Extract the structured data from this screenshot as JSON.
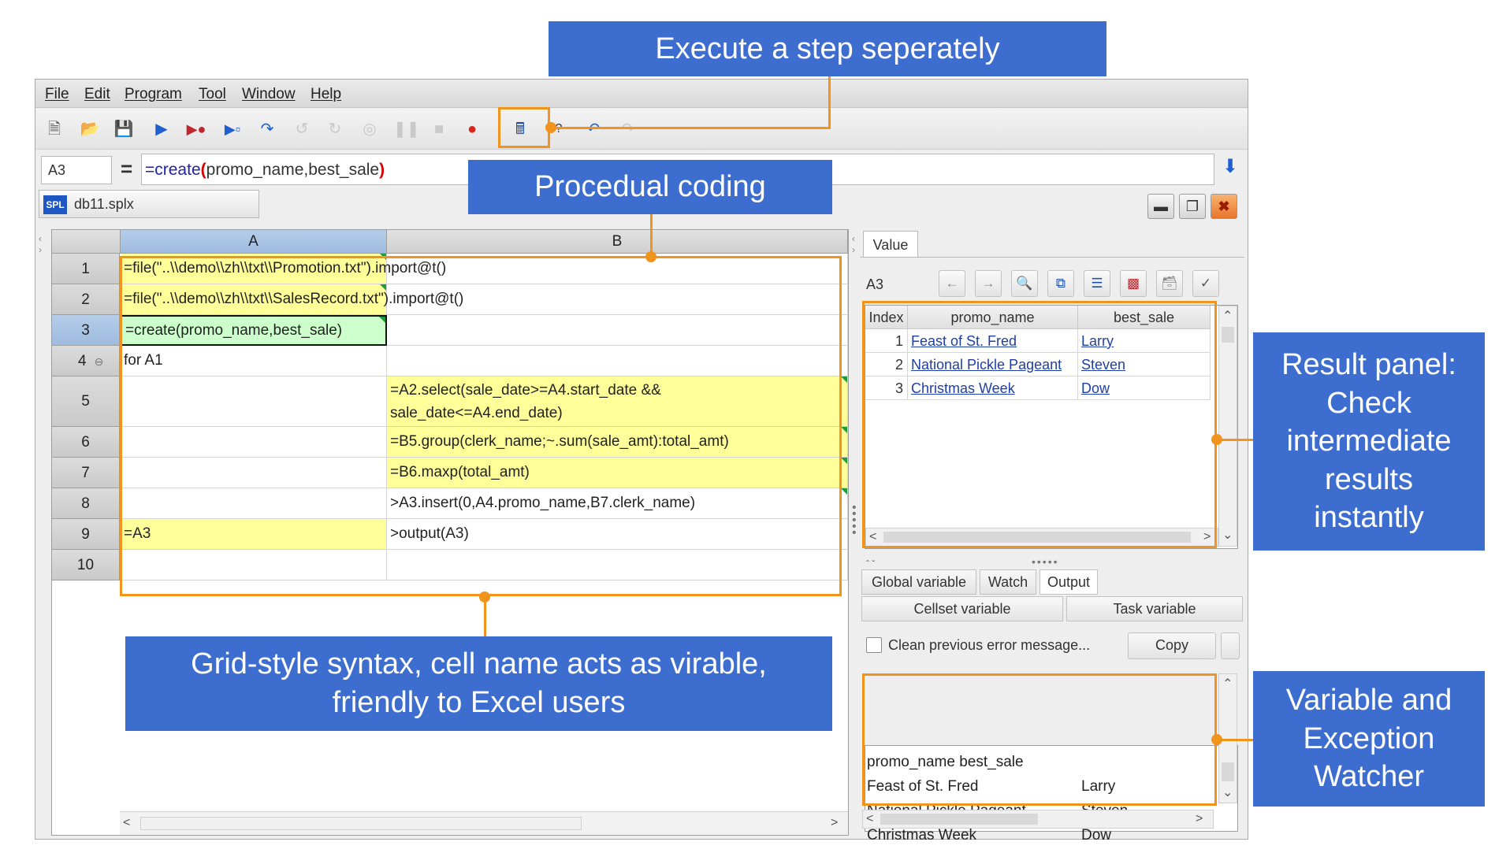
{
  "menu": [
    "File",
    "Edit",
    "Program",
    "Tool",
    "Window",
    "Help"
  ],
  "formula_bar": {
    "cell_ref": "A3",
    "eq": "=",
    "formula_prefix": "=create",
    "formula_open": "(",
    "formula_args": "promo_name,best_sale",
    "formula_close": ")"
  },
  "file_tab": {
    "logo": "SPL",
    "name": "db11.splx"
  },
  "grid": {
    "columns": [
      "A",
      "B"
    ],
    "rows": [
      "1",
      "2",
      "3",
      "4",
      "5",
      "6",
      "7",
      "8",
      "9",
      "10"
    ],
    "cells": {
      "a1": "=file(\"..\\\\demo\\\\zh\\\\txt\\\\Promotion.txt\").import@t()",
      "a2": "=file(\"..\\\\demo\\\\zh\\\\txt\\\\SalesRecord.txt\").import@t()",
      "a3": "=create(promo_name,best_sale)",
      "a4": "for A1",
      "b5_line1": "=A2.select(sale_date>=A4.start_date &&",
      "b5_line2": "sale_date<=A4.end_date)",
      "b6": "=B5.group(clerk_name;~.sum(sale_amt):total_amt)",
      "b7": "=B6.maxp(total_amt)",
      "b8": ">A3.insert(0,A4.promo_name,B7.clerk_name)",
      "a9": "=A3",
      "b9": ">output(A3)"
    }
  },
  "value_panel": {
    "tab": "Value",
    "cell_ref": "A3",
    "headers": [
      "Index",
      "promo_name",
      "best_sale"
    ],
    "rows": [
      {
        "index": "1",
        "promo_name": "Feast of St. Fred",
        "best_sale": "Larry"
      },
      {
        "index": "2",
        "promo_name": "National Pickle Pageant",
        "best_sale": "Steven"
      },
      {
        "index": "3",
        "promo_name": "Christmas Week",
        "best_sale": "Dow"
      }
    ]
  },
  "lower_panel": {
    "tabs": [
      "Global variable",
      "Watch",
      "Output"
    ],
    "subtabs": [
      "Cellset variable",
      "Task variable"
    ],
    "checkbox_label": "Clean previous error message...",
    "copy_button": "Copy",
    "output_lines": [
      {
        "a": "promo_name best_sale",
        "b": ""
      },
      {
        "a": "Feast of St. Fred",
        "b": "Larry"
      },
      {
        "a": "National Pickle Pageant",
        "b": "Steven"
      },
      {
        "a": "Christmas Week",
        "b": "Dow"
      }
    ]
  },
  "callouts": {
    "execute": "Execute a step seperately",
    "procedural": "Procedual coding",
    "result_panel": [
      "Result panel:",
      "Check",
      "intermediate",
      "results",
      "instantly"
    ],
    "grid_syntax": [
      "Grid-style syntax, cell name acts as virable,",
      "friendly to Excel users"
    ],
    "watcher": [
      "Variable and",
      "Exception",
      "Watcher"
    ]
  },
  "colors": {
    "callout_blue": "#3d6ecf",
    "highlight_orange": "#f0941e",
    "cell_yellow": "#ffff99",
    "cell_green": "#ccffcc"
  },
  "icons": [
    "new-file-icon",
    "open-folder-icon",
    "save-icon",
    "run-icon",
    "debug-run-icon",
    "step-icon",
    "step-into-icon",
    "breakpoint-icon",
    "calc-step-icon",
    "undo-icon"
  ]
}
